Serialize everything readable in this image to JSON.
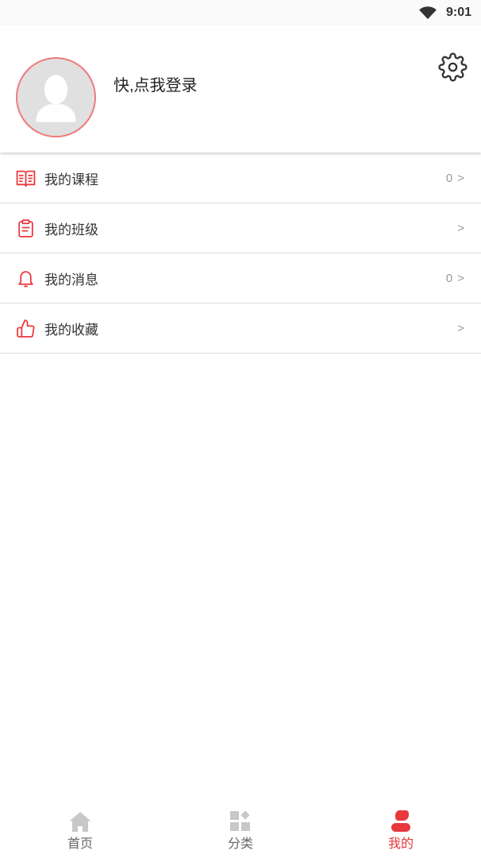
{
  "status_bar": {
    "time": "9:01",
    "icons": [
      "wifi-icon"
    ]
  },
  "header": {
    "login_text": "快,点我登录",
    "avatar_icon": "default-avatar-icon",
    "settings_icon": "gear-icon"
  },
  "menu": [
    {
      "label": "我的课程",
      "icon": "book-icon",
      "count": "0",
      "arrow": ">"
    },
    {
      "label": "我的班级",
      "icon": "clipboard-icon",
      "arrow": ">"
    },
    {
      "label": "我的消息",
      "icon": "bell-icon",
      "count": "0",
      "arrow": ">"
    },
    {
      "label": "我的收藏",
      "icon": "thumbs-up-icon",
      "arrow": ">"
    }
  ],
  "tabbar": [
    {
      "label": "首页",
      "icon": "home-icon",
      "active": false
    },
    {
      "label": "分类",
      "icon": "grid-icon",
      "active": false
    },
    {
      "label": "我的",
      "icon": "person-icon",
      "active": true
    }
  ],
  "colors": {
    "accent": "#e8383d",
    "inactive_icon": "#c8c8c8",
    "avatar_border": "#ef7b7b",
    "divider": "#dcdcdc"
  }
}
